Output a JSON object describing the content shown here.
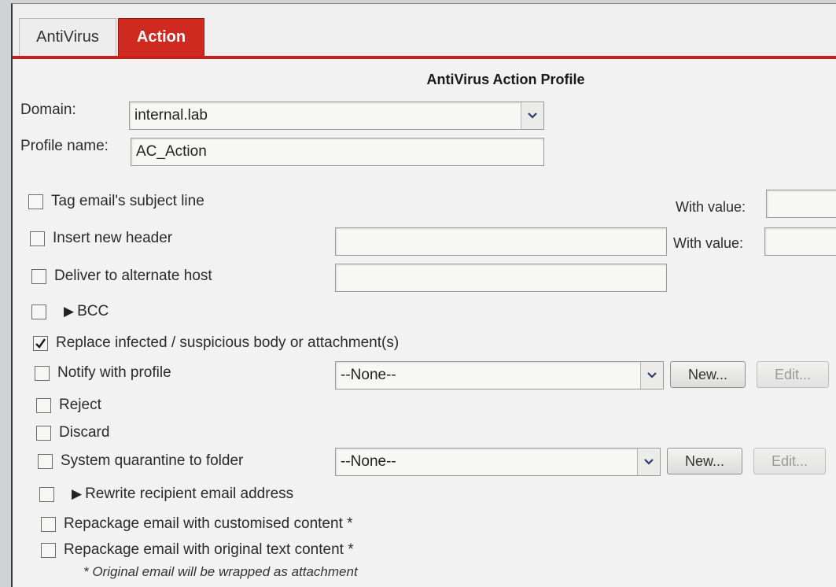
{
  "tabs": [
    {
      "label": "AntiVirus",
      "active": false
    },
    {
      "label": "Action",
      "active": true
    }
  ],
  "heading": "AntiVirus Action Profile",
  "domain": {
    "label": "Domain:",
    "value": "internal.lab"
  },
  "profile_name": {
    "label": "Profile name:",
    "value": "AC_Action"
  },
  "options": {
    "tag_subject": {
      "label": "Tag email's subject line",
      "checked": false,
      "with_value_label": "With value:",
      "value": ""
    },
    "insert_header": {
      "label": "Insert new header",
      "checked": false,
      "header_value": "",
      "with_value_label": "With value:",
      "value": ""
    },
    "deliver_alternate": {
      "label": "Deliver to alternate host",
      "checked": false,
      "host_value": ""
    },
    "bcc": {
      "label": "BCC",
      "checked": false
    },
    "replace_infected": {
      "label": "Replace infected / suspicious body or attachment(s)",
      "checked": true
    },
    "notify_profile": {
      "label": "Notify with profile",
      "checked": false,
      "select_value": "--None--",
      "new_label": "New...",
      "edit_label": "Edit..."
    },
    "reject": {
      "label": "Reject",
      "checked": false
    },
    "discard": {
      "label": "Discard",
      "checked": false
    },
    "system_quarantine": {
      "label": "System quarantine to folder",
      "checked": false,
      "select_value": "--None--",
      "new_label": "New...",
      "edit_label": "Edit..."
    },
    "rewrite_recipient": {
      "label": "Rewrite recipient email address",
      "checked": false
    },
    "repackage_custom": {
      "label": "Repackage email with customised content *",
      "checked": false
    },
    "repackage_original": {
      "label": "Repackage email with original text content *",
      "checked": false
    }
  },
  "footnote": "* Original email will be wrapped as attachment",
  "colors": {
    "accent": "#cf2a20",
    "panel": "#f1f2f1"
  },
  "icons": {
    "combo": "chevron-down-icon",
    "expand": "triangle-right-icon",
    "check": "check-icon"
  }
}
